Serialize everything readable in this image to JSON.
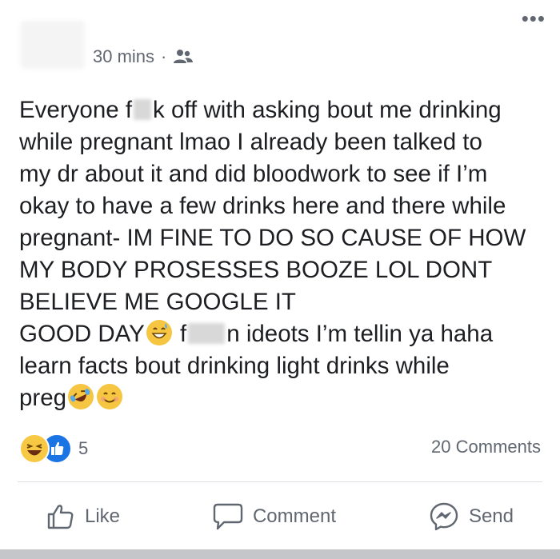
{
  "post": {
    "timestamp": "30 mins",
    "separator": "·",
    "audience_icon": "friends-icon",
    "text": {
      "l1a": "Everyone f",
      "l1b": "k off with asking bout me drinking",
      "l2": "while pregnant lmao I already been talked to",
      "l3": "my dr about it and did bloodwork to see if I’m",
      "l4": "okay to have a few drinks here and there while",
      "l5": "pregnant- IM FINE TO DO SO CAUSE OF HOW",
      "l6": "MY BODY PROSESSES BOOZE LOL DONT",
      "l7": "BELIEVE ME GOOGLE IT",
      "l8a": "GOOD DAY",
      "l8b": " f",
      "l8c": "n ideots I’m tellin ya haha",
      "l9": "learn facts bout drinking light drinks while",
      "l10": "preg"
    }
  },
  "reactions": {
    "types": [
      "haha",
      "like"
    ],
    "count": "5"
  },
  "comments_label": "20 Comments",
  "actions": {
    "like": "Like",
    "comment": "Comment",
    "send": "Send"
  }
}
